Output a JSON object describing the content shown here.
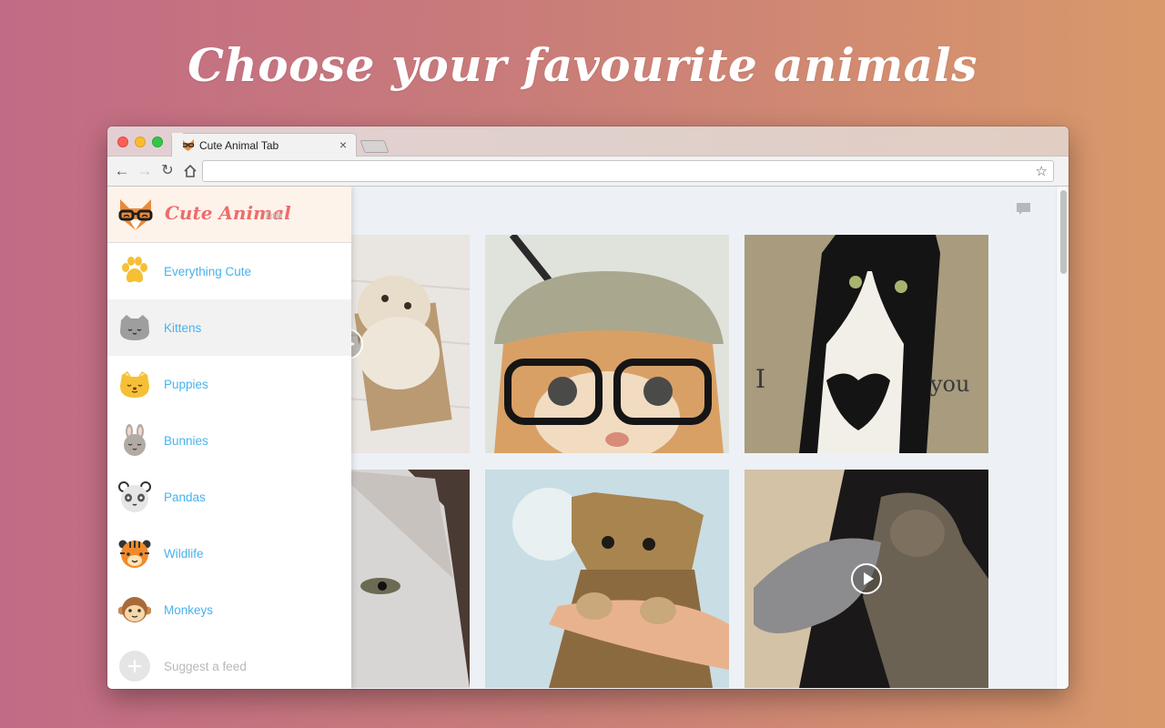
{
  "headline": "Choose your favourite animals",
  "browser": {
    "tab": {
      "title": "Cute Animal Tab",
      "favicon": "fox-glasses-icon",
      "close": "×"
    },
    "toolbar": {
      "back": "←",
      "forward": "→",
      "reload": "↻",
      "home": "⌂",
      "address_value": "",
      "bookmark": "☆"
    }
  },
  "sidebar": {
    "brand": {
      "name": "Cute Animal",
      "sub": "Tab"
    },
    "items": [
      {
        "label": "Everything Cute",
        "icon": "paw-icon",
        "active": false
      },
      {
        "label": "Kittens",
        "icon": "kitten-icon",
        "active": true
      },
      {
        "label": "Puppies",
        "icon": "puppy-icon",
        "active": false
      },
      {
        "label": "Bunnies",
        "icon": "bunny-icon",
        "active": false
      },
      {
        "label": "Pandas",
        "icon": "panda-icon",
        "active": false
      },
      {
        "label": "Wildlife",
        "icon": "tiger-icon",
        "active": false
      },
      {
        "label": "Monkeys",
        "icon": "monkey-icon",
        "active": false
      }
    ],
    "suggest": {
      "label": "Suggest a feed",
      "icon": "plus-icon"
    }
  },
  "feed": {
    "photos": [
      {
        "subject": "kitten in cardboard box",
        "video": true
      },
      {
        "subject": "kitten wearing beanie and glasses",
        "video": false
      },
      {
        "subject": "tuxedo cat with heart-shaped patch",
        "caption_left": "I",
        "caption_right": "you",
        "video": false
      },
      {
        "subject": "white kitten close-up",
        "video": false
      },
      {
        "subject": "tabby kitten held in hand",
        "video": false
      },
      {
        "subject": "two tabby cats cuddling",
        "video": true
      }
    ]
  },
  "colors": {
    "accent_blue": "#47b2f0",
    "brand_red": "#ee6c6c",
    "sidebar_header_bg": "#fdf3ea",
    "content_bg": "#edf1f5"
  }
}
